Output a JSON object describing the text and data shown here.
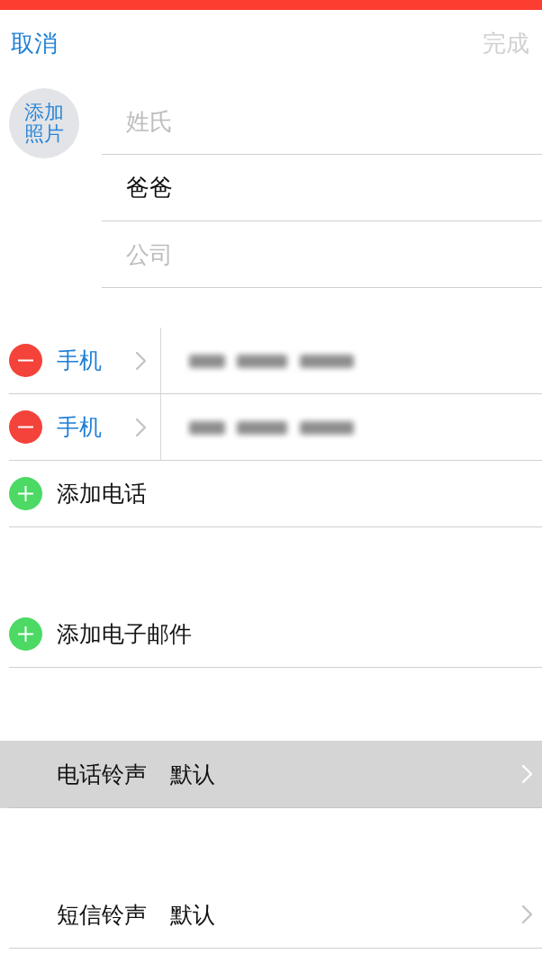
{
  "nav": {
    "cancel": {
      "label": "取消"
    },
    "done": {
      "label": "完成",
      "disabled": true
    }
  },
  "photo": {
    "label": "添加照片"
  },
  "name_fields": [
    {
      "placeholder": "姓氏"
    },
    {
      "value": "爸爸"
    },
    {
      "placeholder": "公司"
    }
  ],
  "phone_section": {
    "numbers": [
      {
        "label": "手机"
      },
      {
        "label": "手机"
      }
    ],
    "add_label": "添加电话"
  },
  "email_section": {
    "add_label": "添加电子邮件"
  },
  "tones": [
    {
      "label": "电话铃声",
      "value": "默认",
      "selected": true
    },
    {
      "label": "短信铃声",
      "value": "默认",
      "selected": false
    }
  ]
}
